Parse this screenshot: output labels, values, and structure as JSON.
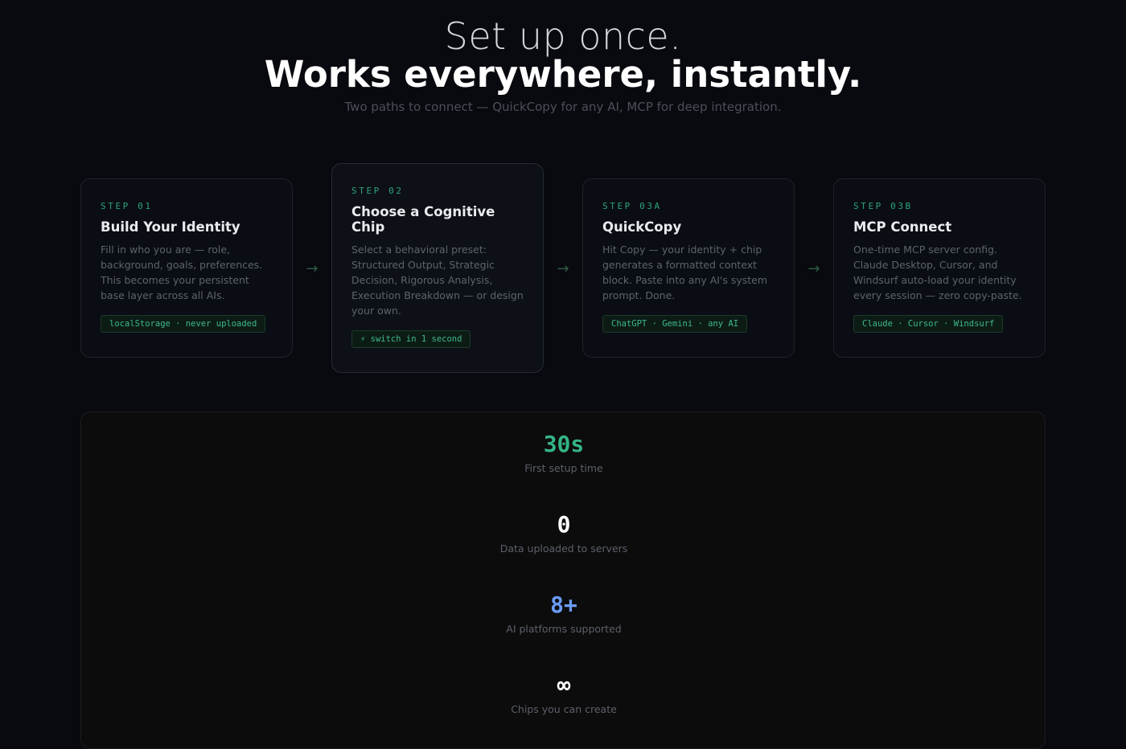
{
  "hero": {
    "line1": "Set up once.",
    "line2": "Works everywhere, instantly.",
    "subtitle": "Two paths to connect — QuickCopy for any AI, MCP for deep integration."
  },
  "steps": [
    {
      "label": "STEP 01",
      "title": "Build Your Identity",
      "description": "Fill in who you are — role, background, goals, preferences. This becomes your persistent base layer across all AIs.",
      "tag": "localStorage · never uploaded"
    },
    {
      "label": "STEP 02",
      "title": "Choose a Cognitive Chip",
      "description": "Select a behavioral preset: Structured Output, Strategic Decision, Rigorous Analysis, Execution Breakdown — or design your own.",
      "tag": "⚡ switch in 1 second"
    },
    {
      "label": "STEP 03A",
      "title": "QuickCopy",
      "description": "Hit Copy — your identity + chip generates a formatted context block. Paste into any AI's system prompt. Done.",
      "tag": "ChatGPT · Gemini · any AI"
    },
    {
      "label": "STEP 03B",
      "title": "MCP Connect",
      "description": "One-time MCP server config. Claude Desktop, Cursor, and Windsurf auto-load your identity every session — zero copy-paste.",
      "tag": "Claude · Cursor · Windsurf"
    }
  ],
  "arrow_glyph": "→",
  "stats": [
    {
      "value": "30s",
      "label": "First setup time",
      "color": "#34b585"
    },
    {
      "value": "0",
      "label": "Data uploaded to servers",
      "color": "#ffffff"
    },
    {
      "value": "8+",
      "label": "AI platforms supported",
      "color": "#6b9bf5"
    },
    {
      "value": "∞",
      "label": "Chips you can create",
      "color": "#ffffff"
    }
  ]
}
